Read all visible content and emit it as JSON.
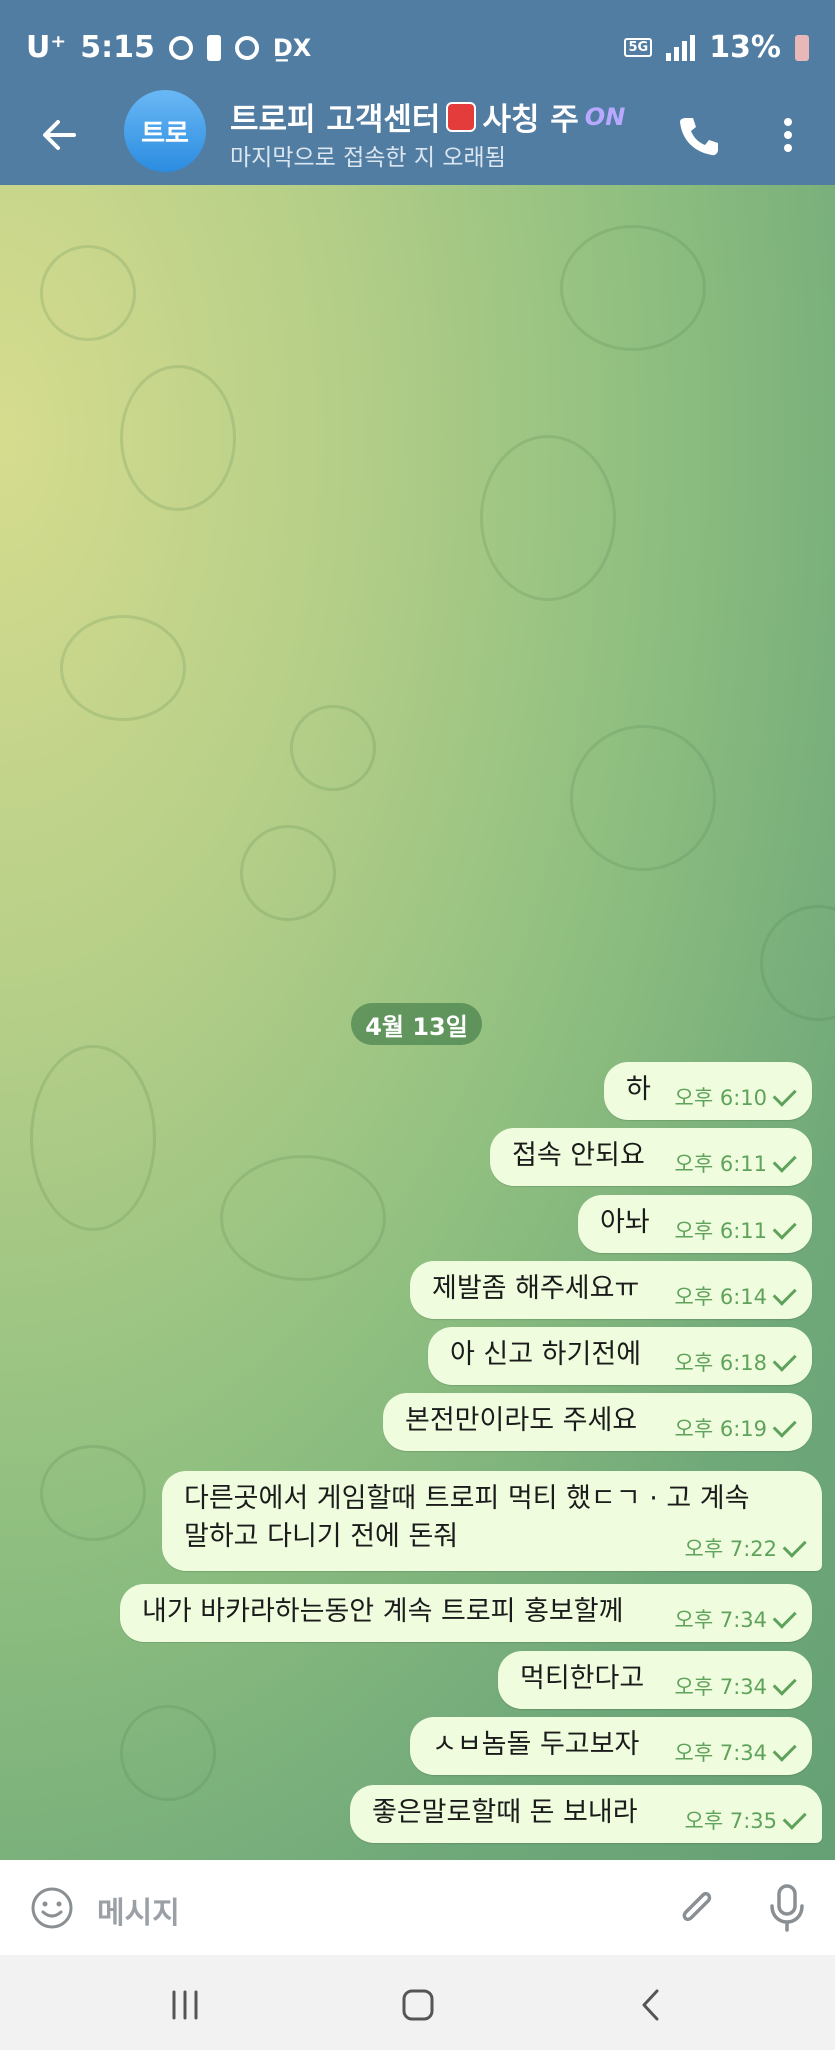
{
  "status_bar": {
    "carrier": "U⁺",
    "time": "5:15",
    "extra": "D̲X",
    "network": "5G",
    "battery": "13%"
  },
  "header": {
    "avatar_initials": "트로",
    "title": "트로피 고객센터",
    "title_suffix": "사칭 주",
    "title_badge": "ON",
    "subtitle": "마지막으로 접속한 지 오래됨"
  },
  "chat": {
    "date_label": "4월 13일",
    "messages": [
      {
        "text": "하",
        "time": "오후 6:10"
      },
      {
        "text": "접속 안되요",
        "time": "오후 6:11"
      },
      {
        "text": "아놔",
        "time": "오후 6:11"
      },
      {
        "text": "제발좀 해주세요ㅠ",
        "time": "오후 6:14"
      },
      {
        "text": "아 신고 하기전에",
        "time": "오후 6:18"
      },
      {
        "text": "본전만이라도 주세요",
        "time": "오후 6:19"
      },
      {
        "text": "다른곳에서 게임할때 트로피 먹티 했ㄷㄱ · 고 계속",
        "text2": "말하고 다니기 전에 돈줘",
        "time": "오후 7:22"
      },
      {
        "text": "내가 바카라하는동안 계속 트로피 홍보할께",
        "time": "오후 7:34"
      },
      {
        "text": "먹티한다고",
        "time": "오후 7:34"
      },
      {
        "text": "ㅅㅂ놈돌 두고보자",
        "time": "오후 7:34"
      },
      {
        "text": "좋은말로할때 돈 보내라",
        "time": "오후 7:35"
      }
    ]
  },
  "input": {
    "placeholder": "메시지"
  },
  "colors": {
    "header_bg": "#517da2",
    "bubble_bg": "#effdde",
    "time_color": "#5fa25b"
  }
}
